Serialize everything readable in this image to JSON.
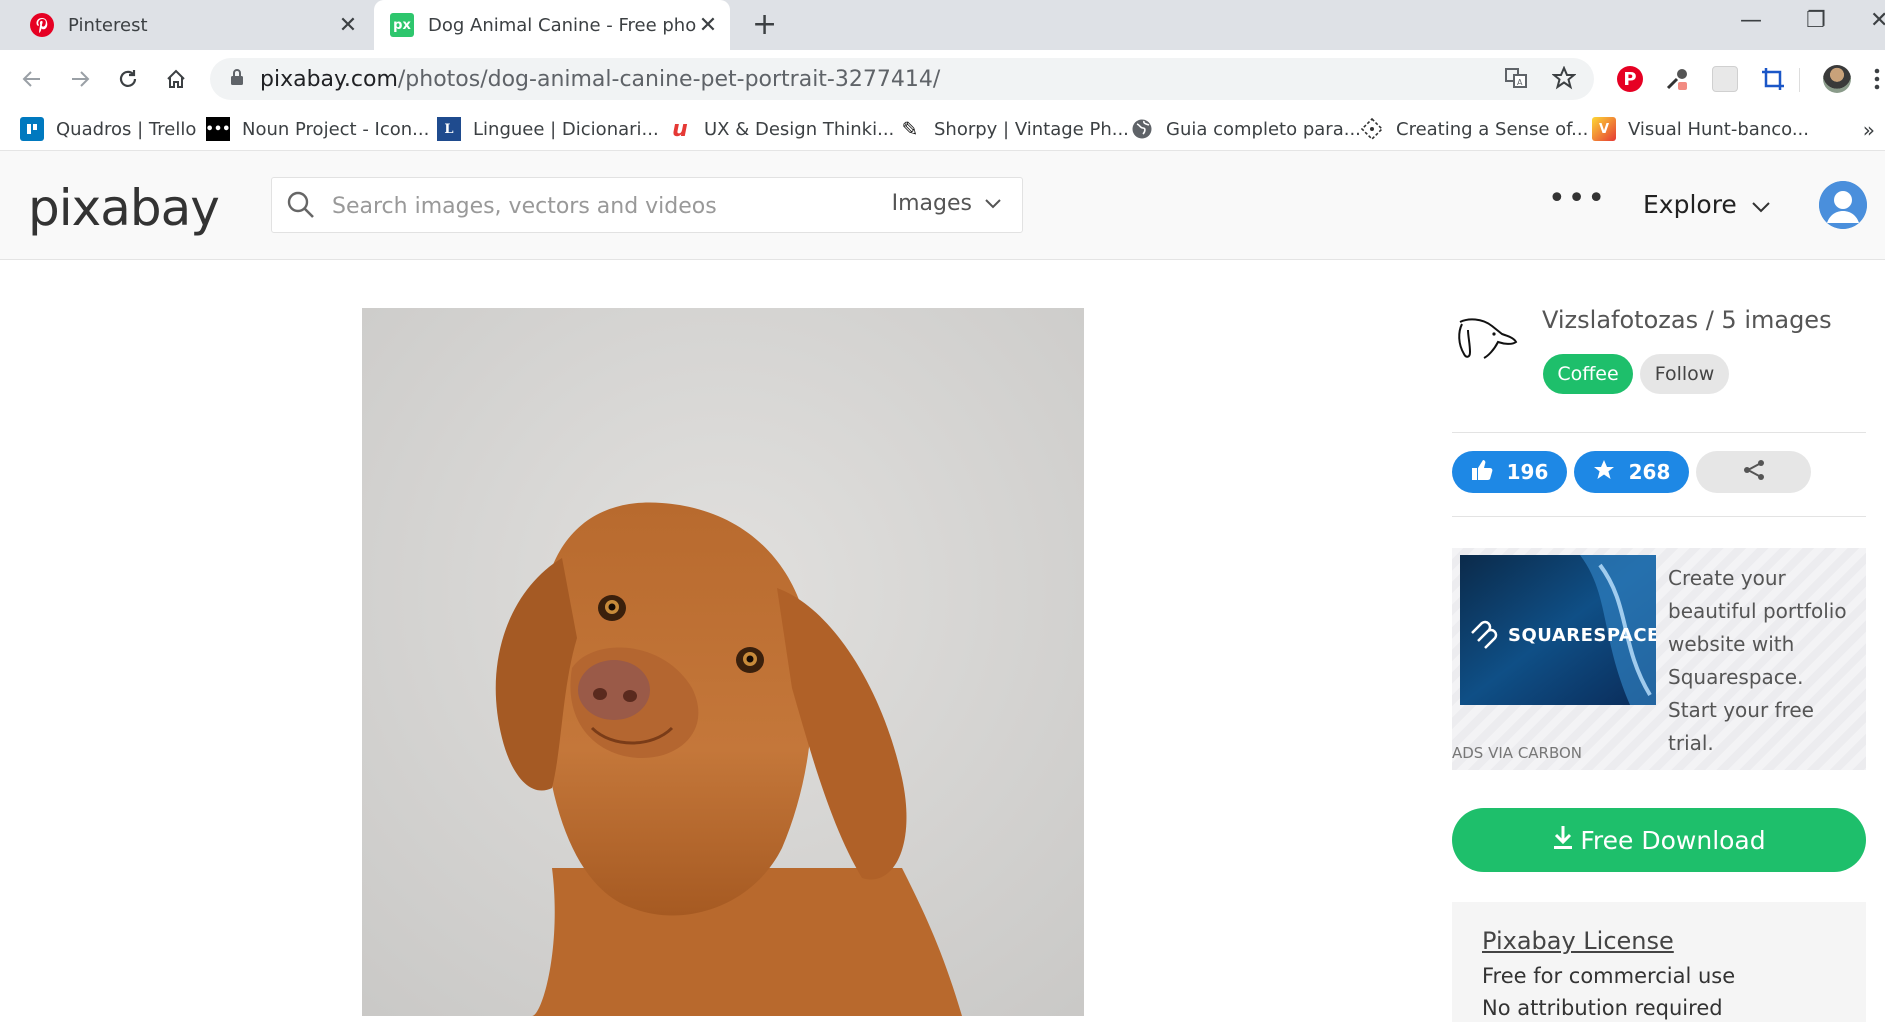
{
  "browser": {
    "tabs": [
      {
        "title": "Pinterest",
        "active": false
      },
      {
        "title": "Dog Animal Canine - Free photo",
        "active": true
      }
    ],
    "url_host": "pixabay.com",
    "url_path": "/photos/dog-animal-canine-pet-portrait-3277414/",
    "bookmarks": [
      {
        "label": "Quadros | Trello",
        "icon": "trello-icon"
      },
      {
        "label": "Noun Project - Icon...",
        "icon": "noun-project-icon"
      },
      {
        "label": "Linguee | Dicionari...",
        "icon": "linguee-icon"
      },
      {
        "label": "UX & Design Thinki...",
        "icon": "ux-design-icon"
      },
      {
        "label": "Shorpy | Vintage Ph...",
        "icon": "shorpy-icon"
      },
      {
        "label": "Guia completo para...",
        "icon": "globe-icon"
      },
      {
        "label": "Creating a Sense of...",
        "icon": "diamond-icon"
      },
      {
        "label": "Visual Hunt-banco...",
        "icon": "visual-hunt-icon"
      }
    ]
  },
  "header": {
    "logo": "pixabay",
    "search_placeholder": "Search images, vectors and videos",
    "search_type": "Images",
    "more_label": "•••",
    "explore_label": "Explore"
  },
  "author": {
    "name_line": "Vizslafotozas / 5 images",
    "coffee_label": "Coffee",
    "follow_label": "Follow"
  },
  "stats": {
    "likes": "196",
    "favorites": "268"
  },
  "ad": {
    "brand": "SQUARESPACE",
    "text": "Create your beautiful portfolio website with Squarespace. Start your free trial.",
    "via": "ADS VIA CARBON"
  },
  "download": {
    "label": "Free Download"
  },
  "license": {
    "title": "Pixabay License",
    "lines": [
      "Free for commercial use",
      "No attribution required"
    ]
  },
  "colors": {
    "green": "#1ebf6b",
    "blue": "#1e88e5",
    "pinterest_red": "#e60023"
  }
}
